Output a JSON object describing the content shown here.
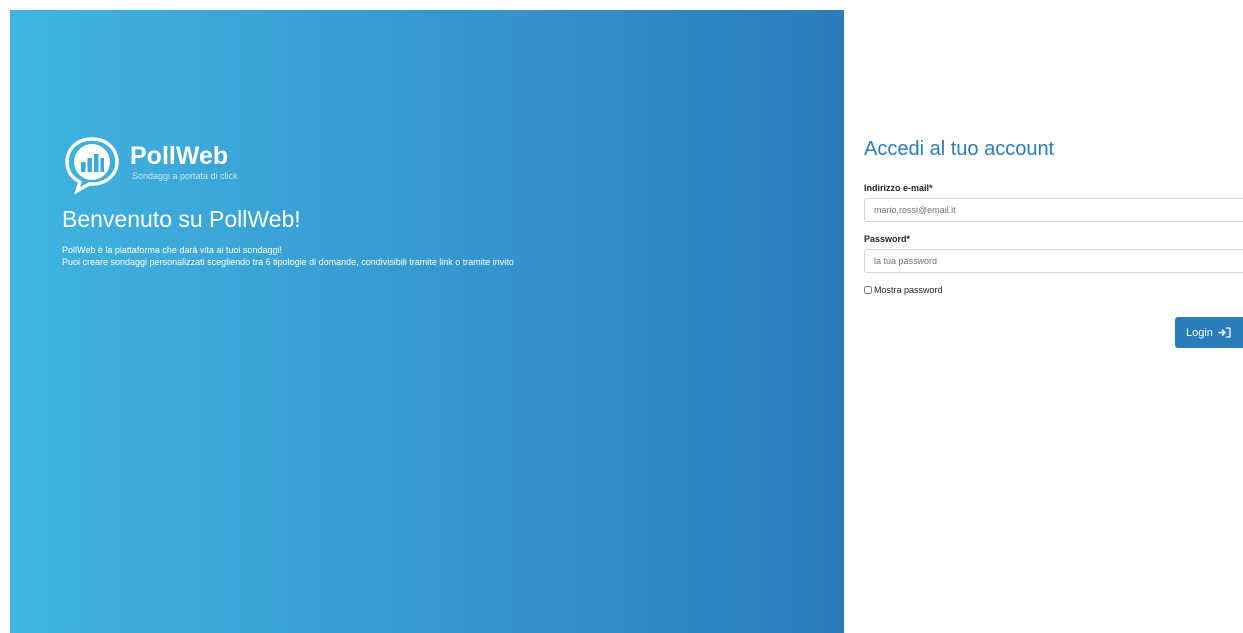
{
  "hero": {
    "logo": {
      "name": "PollWeb",
      "tagline": "Sondaggi a portata di click"
    },
    "title": "Benvenuto su PollWeb!",
    "description_lines": [
      "PollWeb è la piattaforma che darà vita ai tuoi sondaggi!",
      "Puoi creare sondaggi personalizzati scegliendo tra 6 tipologie di domande, condivisibili tramite link o tramite invito"
    ],
    "gradient_start": "#40b4e0",
    "gradient_end": "#2b7bbb"
  },
  "login": {
    "title": "Accedi al tuo account",
    "email_label": "Indirizzo e-mail*",
    "email_placeholder": "mario.rossi@email.it",
    "password_label": "Password*",
    "password_placeholder": "la tua password",
    "show_password_label": "Mostra password",
    "show_password_checked": false,
    "submit_label": "Login",
    "submit_icon": "sign-in-icon",
    "accent_color": "#2b7cbb"
  }
}
